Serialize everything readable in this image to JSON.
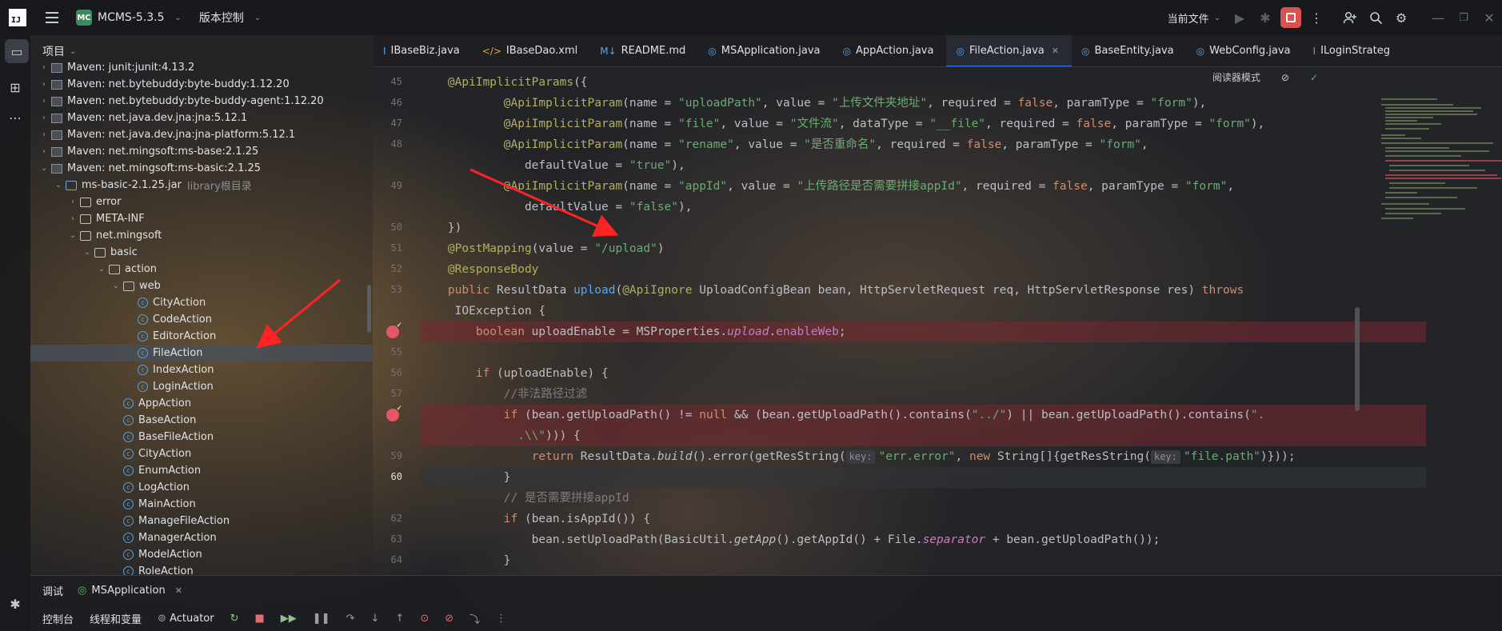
{
  "titlebar": {
    "logo": "IJ",
    "project_badge": "MC",
    "project_name": "MCMS-5.3.5",
    "vcs": "版本控制",
    "run_config": "当前文件"
  },
  "panel": {
    "title": "项目",
    "tree": [
      {
        "label": "Maven: junit:junit:4.13.2",
        "type": "lib",
        "level": 1,
        "expand": "collapsed"
      },
      {
        "label": "Maven: net.bytebuddy:byte-buddy:1.12.20",
        "type": "lib",
        "level": 1,
        "expand": "collapsed"
      },
      {
        "label": "Maven: net.bytebuddy:byte-buddy-agent:1.12.20",
        "type": "lib",
        "level": 1,
        "expand": "collapsed"
      },
      {
        "label": "Maven: net.java.dev.jna:jna:5.12.1",
        "type": "lib",
        "level": 1,
        "expand": "collapsed"
      },
      {
        "label": "Maven: net.java.dev.jna:jna-platform:5.12.1",
        "type": "lib",
        "level": 1,
        "expand": "collapsed"
      },
      {
        "label": "Maven: net.mingsoft:ms-base:2.1.25",
        "type": "lib",
        "level": 1,
        "expand": "collapsed"
      },
      {
        "label": "Maven: net.mingsoft:ms-basic:2.1.25",
        "type": "lib",
        "level": 1,
        "expand": "expanded"
      },
      {
        "label": "ms-basic-2.1.25.jar",
        "suffix": "library根目录",
        "type": "jar",
        "level": 2,
        "expand": "expanded"
      },
      {
        "label": "error",
        "type": "folder",
        "level": 3,
        "expand": "collapsed"
      },
      {
        "label": "META-INF",
        "type": "folder",
        "level": 3,
        "expand": "collapsed"
      },
      {
        "label": "net.mingsoft",
        "type": "folder",
        "level": 3,
        "expand": "expanded"
      },
      {
        "label": "basic",
        "type": "folder",
        "level": 4,
        "expand": "expanded"
      },
      {
        "label": "action",
        "type": "folder",
        "level": 5,
        "expand": "expanded"
      },
      {
        "label": "web",
        "type": "folder",
        "level": 6,
        "expand": "expanded"
      },
      {
        "label": "CityAction",
        "type": "class",
        "level": 7,
        "expand": "none"
      },
      {
        "label": "CodeAction",
        "type": "class",
        "level": 7,
        "expand": "none"
      },
      {
        "label": "EditorAction",
        "type": "class",
        "level": 7,
        "expand": "none"
      },
      {
        "label": "FileAction",
        "type": "class",
        "level": 7,
        "expand": "none",
        "selected": true
      },
      {
        "label": "IndexAction",
        "type": "class",
        "level": 7,
        "expand": "none"
      },
      {
        "label": "LoginAction",
        "type": "class",
        "level": 7,
        "expand": "none"
      },
      {
        "label": "AppAction",
        "type": "class",
        "level": 6,
        "expand": "none"
      },
      {
        "label": "BaseAction",
        "type": "class",
        "level": 6,
        "expand": "none"
      },
      {
        "label": "BaseFileAction",
        "type": "class",
        "level": 6,
        "expand": "none"
      },
      {
        "label": "CityAction",
        "type": "class",
        "level": 6,
        "expand": "none"
      },
      {
        "label": "EnumAction",
        "type": "class",
        "level": 6,
        "expand": "none"
      },
      {
        "label": "LogAction",
        "type": "class",
        "level": 6,
        "expand": "none"
      },
      {
        "label": "MainAction",
        "type": "class",
        "level": 6,
        "expand": "none"
      },
      {
        "label": "ManageFileAction",
        "type": "class",
        "level": 6,
        "expand": "none"
      },
      {
        "label": "ManagerAction",
        "type": "class",
        "level": 6,
        "expand": "none"
      },
      {
        "label": "ModelAction",
        "type": "class",
        "level": 6,
        "expand": "none"
      },
      {
        "label": "RoleAction",
        "type": "class",
        "level": 6,
        "expand": "none"
      }
    ]
  },
  "tabs": [
    {
      "label": "IBaseBiz.java",
      "icon": "I",
      "color": "#5aa2e0"
    },
    {
      "label": "IBaseDao.xml",
      "icon": "</>",
      "color": "#e8a23c"
    },
    {
      "label": "README.md",
      "icon": "M↓",
      "color": "#5aa2e0"
    },
    {
      "label": "MSApplication.java",
      "icon": "◎",
      "color": "#5aa2e0"
    },
    {
      "label": "AppAction.java",
      "icon": "◎",
      "color": "#5aa2e0"
    },
    {
      "label": "FileAction.java",
      "icon": "◎",
      "color": "#5aa2e0",
      "active": true
    },
    {
      "label": "BaseEntity.java",
      "icon": "◎",
      "color": "#5aa2e0"
    },
    {
      "label": "WebConfig.java",
      "icon": "◎",
      "color": "#5aa2e0"
    },
    {
      "label": "ILoginStrateg",
      "icon": "I",
      "color": "#5aa2e0"
    }
  ],
  "editor": {
    "reader_mode": "阅读器模式",
    "lines": [
      {
        "n": "45",
        "html": "<span class=\"an\">@ApiImplicitParams</span>({"
      },
      {
        "n": "46",
        "html": "        <span class=\"an\">@ApiImplicitParam</span>(name = <span class=\"s\">\"uploadPath\"</span>, value = <span class=\"s\">\"上传文件夹地址\"</span>, required = <span class=\"k\">false</span>, paramType = <span class=\"s\">\"form\"</span>),"
      },
      {
        "n": "47",
        "html": "        <span class=\"an\">@ApiImplicitParam</span>(name = <span class=\"s\">\"file\"</span>, value = <span class=\"s\">\"文件流\"</span>, dataType = <span class=\"s\">\"__file\"</span>, required = <span class=\"k\">false</span>, paramType = <span class=\"s\">\"form\"</span>),"
      },
      {
        "n": "48",
        "html": "        <span class=\"an\">@ApiImplicitParam</span>(name = <span class=\"s\">\"rename\"</span>, value = <span class=\"s\">\"是否重命名\"</span>, required = <span class=\"k\">false</span>, paramType = <span class=\"s\">\"form\"</span>,"
      },
      {
        "n": "",
        "html": "           defaultValue = <span class=\"s\">\"true\"</span>),"
      },
      {
        "n": "49",
        "html": "        <span class=\"an\">@ApiImplicitParam</span>(name = <span class=\"s\">\"appId\"</span>, value = <span class=\"s\">\"上传路径是否需要拼接appId\"</span>, required = <span class=\"k\">false</span>, paramType = <span class=\"s\">\"form\"</span>,"
      },
      {
        "n": "",
        "html": "           defaultValue = <span class=\"s\">\"false\"</span>),"
      },
      {
        "n": "50",
        "html": "})"
      },
      {
        "n": "51",
        "html": "<span class=\"an\">@PostMapping</span>(value = <span class=\"s\">\"/upload\"</span>)"
      },
      {
        "n": "52",
        "html": "<span class=\"an\">@ResponseBody</span>"
      },
      {
        "n": "53",
        "html": "<span class=\"k\">public</span> ResultData <span class=\"m\">upload</span>(<span class=\"an\">@ApiIgnore</span> UploadConfigBean bean, HttpServletRequest req, HttpServletResponse res) <span class=\"k\">throws</span>"
      },
      {
        "n": "",
        "html": " IOException {"
      },
      {
        "n": "",
        "html": "    <span class=\"k\">boolean</span> uploadEnable = MSProperties.<span class=\"f it\">upload</span>.<span class=\"f\">enableWeb</span>;",
        "bp": true,
        "hl": true
      },
      {
        "n": "55",
        "html": ""
      },
      {
        "n": "56",
        "html": "    <span class=\"k\">if</span> (uploadEnable) {"
      },
      {
        "n": "57",
        "html": "        <span class=\"c\">//非法路径过滤</span>"
      },
      {
        "n": "",
        "html": "        <span class=\"k\">if</span> (bean.getUploadPath() != <span class=\"k\">null</span> &amp;&amp; (bean.getUploadPath().contains(<span class=\"s\">\"../\"</span>) || bean.getUploadPath().contains(<span class=\"s\">\".</span>",
        "bp": true,
        "hl": true
      },
      {
        "n": "",
        "html": "          <span class=\"s\">.\\\\\"</span>))) {",
        "hl": true
      },
      {
        "n": "59",
        "html": "            <span class=\"k\">return</span> ResultData.<span class=\"it\">build</span>().error(getResString(<span class=\"hint\">key:</span><span class=\"s\">\"err.error\"</span>, <span class=\"k\">new</span> String[]{getResString(<span class=\"hint\">key:</span><span class=\"s\">\"file.path\"</span>)}));"
      },
      {
        "n": "60",
        "html": "        }",
        "cur": true
      },
      {
        "n": "",
        "html": "        <span class=\"c\">// 是否需要拼接appId</span>"
      },
      {
        "n": "62",
        "html": "        <span class=\"k\">if</span> (bean.isAppId()) {"
      },
      {
        "n": "63",
        "html": "            bean.setUploadPath(BasicUtil.<span class=\"it\">getApp</span>().getAppId() + File.<span class=\"f it\">separator</span> + bean.getUploadPath());"
      },
      {
        "n": "64",
        "html": "        }"
      }
    ]
  },
  "bottom": {
    "tab_debug": "调试",
    "tab_session": "MSApplication",
    "tool_console": "控制台",
    "tool_threads": "线程和变量",
    "tool_actuator": "Actuator"
  }
}
